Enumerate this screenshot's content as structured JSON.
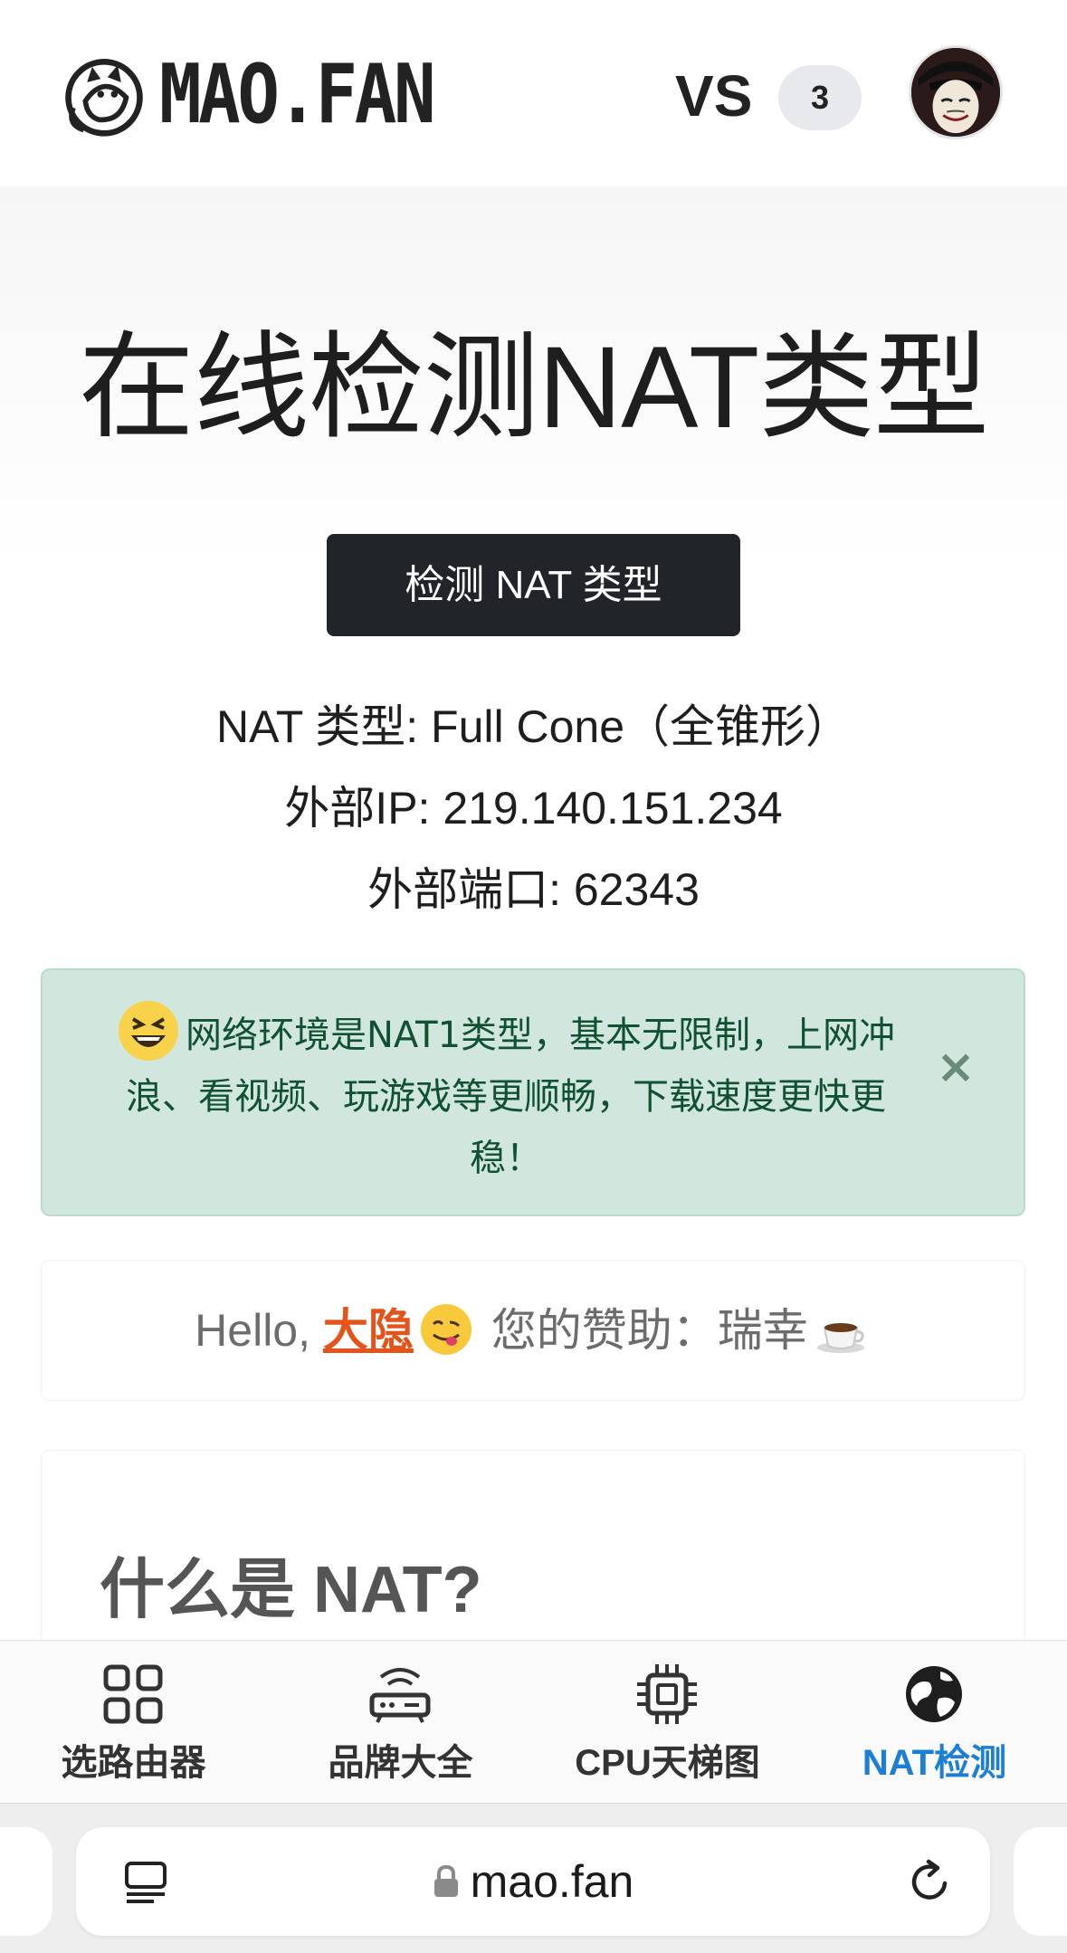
{
  "header": {
    "logo_text": "MAO.FAN",
    "vs_label": "VS",
    "vs_count": "3"
  },
  "main": {
    "title": "在线检测NAT类型",
    "detect_button": "检测 NAT 类型",
    "result": {
      "nat_type": "NAT 类型: Full Cone（全锥形）",
      "external_ip": "外部IP: 219.140.151.234",
      "external_port": "外部端口: 62343"
    },
    "alert": {
      "message": "网络环境是NAT1类型，基本无限制，上网冲浪、看视频、玩游戏等更顺畅，下载速度更快更稳！",
      "close": "×"
    },
    "sponsor": {
      "greeting": "Hello, ",
      "name": "大隐",
      "label": " 您的赞助：瑞幸"
    },
    "section_heading": "什么是 NAT?"
  },
  "bottom_nav": {
    "items": [
      {
        "label": "选路由器",
        "icon": "grid-icon",
        "active": false
      },
      {
        "label": "品牌大全",
        "icon": "router-icon",
        "active": false
      },
      {
        "label": "CPU天梯图",
        "icon": "cpu-icon",
        "active": false
      },
      {
        "label": "NAT检测",
        "icon": "globe-icon",
        "active": true
      }
    ],
    "active_color": "#1c7fd6"
  },
  "browser": {
    "url": "mao.fan"
  },
  "colors": {
    "button_bg": "#212529",
    "alert_bg": "#d1e7dd",
    "alert_text": "#0f5132",
    "sponsor_name": "#e4541a"
  }
}
